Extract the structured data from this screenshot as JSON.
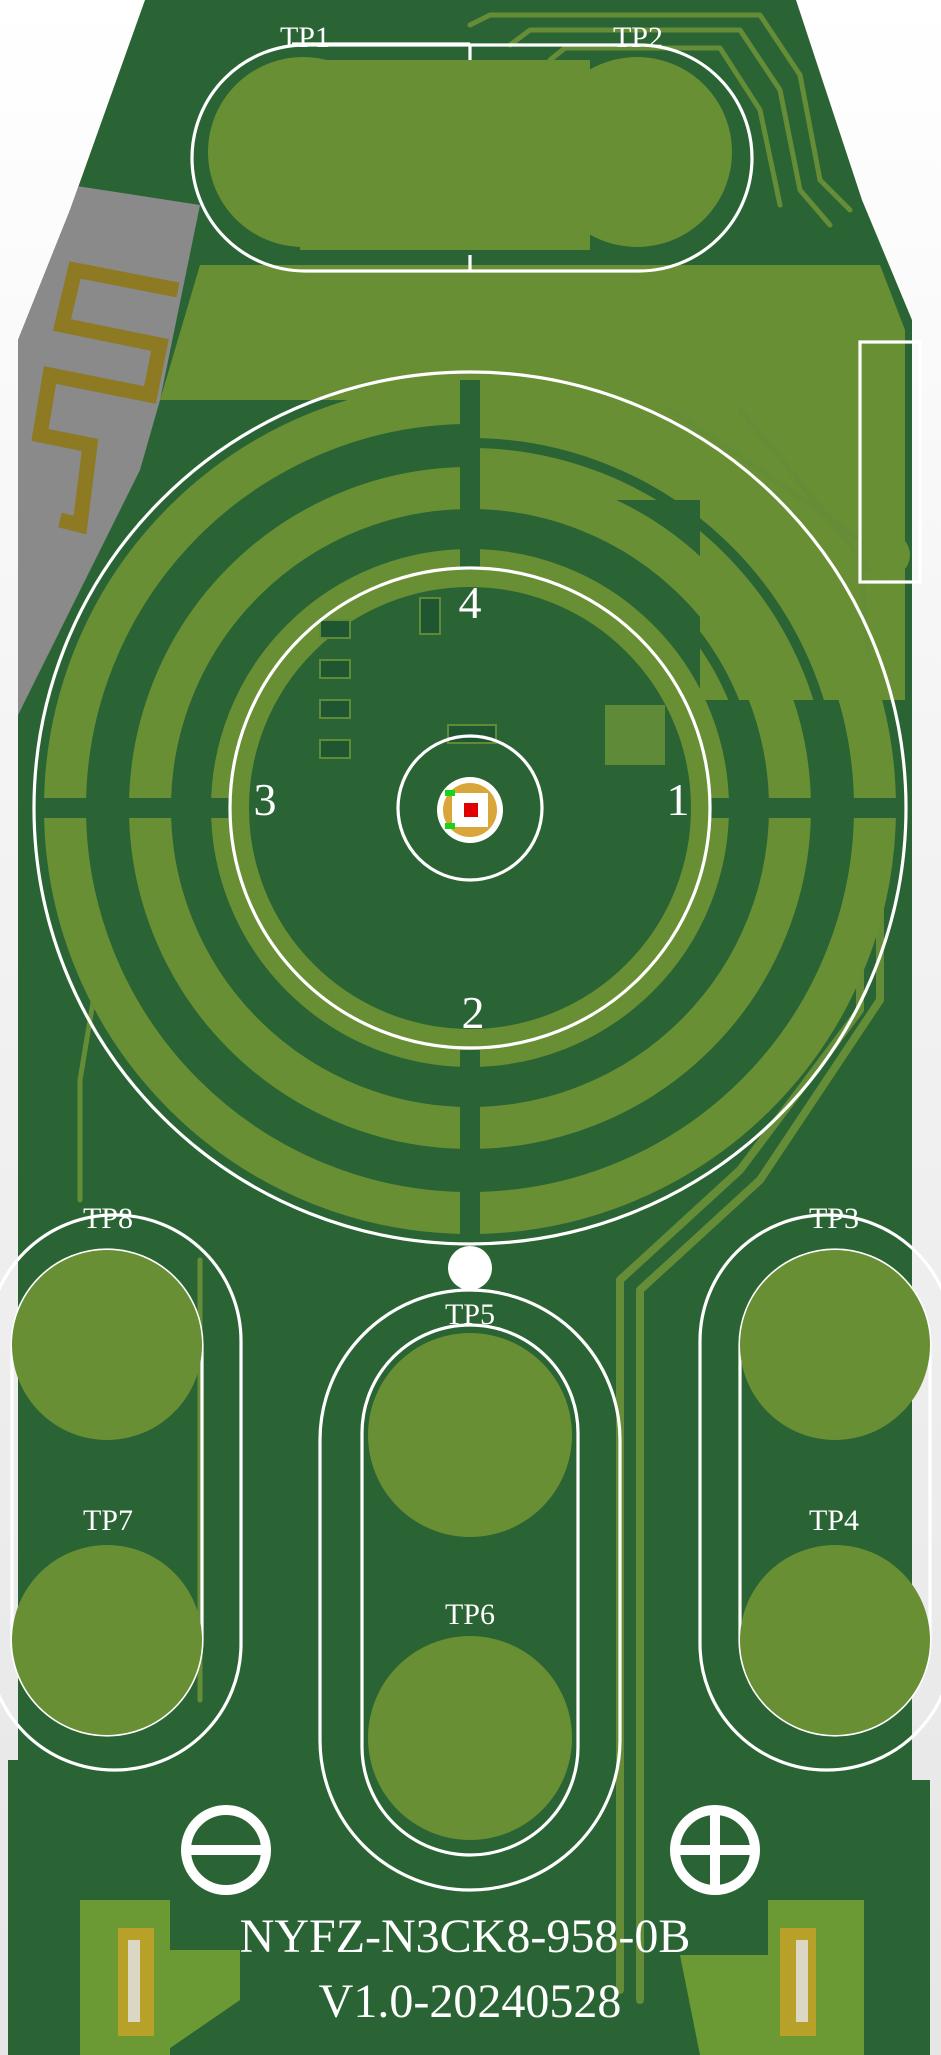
{
  "board": {
    "part_number": "NYFZ-N3CK8-958-0B",
    "version": "V1.0-20240528"
  },
  "test_points": {
    "tp1": "TP1",
    "tp2": "TP2",
    "tp3": "TP3",
    "tp4": "TP4",
    "tp5": "TP5",
    "tp6": "TP6",
    "tp7": "TP7",
    "tp8": "TP8"
  },
  "keypad_labels": {
    "k1": "1",
    "k2": "2",
    "k3": "3",
    "k4": "4"
  },
  "colors": {
    "substrate": "#2a6435",
    "copper_fill": "#688f34",
    "silkscreen": "#ffffff",
    "gold": "#b8a129",
    "antenna_keepout": "#8a8a8a"
  },
  "icons": {
    "minus": "minus-circle-icon",
    "plus": "plus-circle-icon"
  }
}
